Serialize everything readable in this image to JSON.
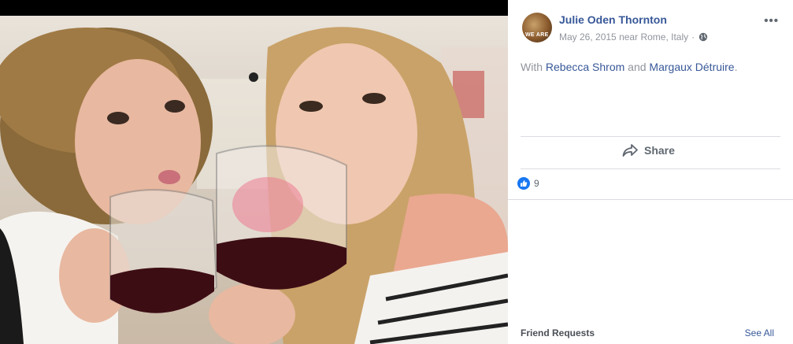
{
  "post": {
    "author": "Julie Oden Thornton",
    "date": "May 26, 2015",
    "location_prefix": "near",
    "location": "Rome, Italy",
    "separator": "·",
    "privacy_icon": "globe-icon",
    "more_label": "•••",
    "with_prefix": "With",
    "tagged": [
      "Rebecca Shrom",
      "Margaux Détruire"
    ],
    "conjunction": "and",
    "suffix": ".",
    "avatar_text": "WE ARE"
  },
  "actions": {
    "share_label": "Share",
    "share_icon": "share-arrow-icon"
  },
  "reactions": {
    "count": "9",
    "icon": "thumbs-up-icon",
    "color": "#1877f2"
  },
  "sidebar": {
    "friend_requests_title": "Friend Requests",
    "see_all_label": "See All"
  },
  "colors": {
    "link": "#385898",
    "muted": "#90949c",
    "divider": "#dadde1"
  }
}
